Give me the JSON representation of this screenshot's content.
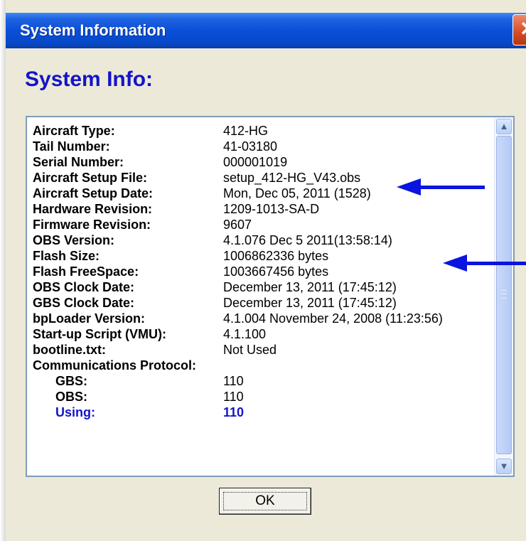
{
  "window": {
    "title": "System Information",
    "close_label": "✕"
  },
  "heading": "System Info:",
  "info_rows": [
    {
      "label": "Aircraft Type:",
      "value": "412-HG"
    },
    {
      "label": "Tail Number:",
      "value": "41-03180"
    },
    {
      "label": "Serial Number:",
      "value": "000001019"
    },
    {
      "label": "Aircraft Setup File:",
      "value": "setup_412-HG_V43.obs"
    },
    {
      "label": "Aircraft Setup Date:",
      "value": "Mon, Dec 05, 2011 (1528)"
    },
    {
      "label": "Hardware Revision:",
      "value": "1209-1013-SA-D"
    },
    {
      "label": "Firmware Revision:",
      "value": "9607"
    },
    {
      "label": "OBS Version:",
      "value": "4.1.076  Dec  5 2011(13:58:14)"
    },
    {
      "label": "Flash Size:",
      "value": "1006862336 bytes"
    },
    {
      "label": "Flash FreeSpace:",
      "value": "1003667456 bytes"
    },
    {
      "label": "OBS Clock Date:",
      "value": "December 13, 2011 (17:45:12)"
    },
    {
      "label": "GBS Clock Date:",
      "value": "December 13, 2011 (17:45:12)"
    },
    {
      "label": "bpLoader Version:",
      "value": "4.1.004 November 24, 2008 (11:23:56)"
    },
    {
      "label": "Start-up Script (VMU):",
      "value": "4.1.100"
    },
    {
      "label": "bootline.txt:",
      "value": "Not Used"
    },
    {
      "label": "Communications Protocol:",
      "value": ""
    },
    {
      "label": "GBS:",
      "value": "110"
    },
    {
      "label": "OBS:",
      "value": "110"
    },
    {
      "label": "Using:",
      "value": "110"
    }
  ],
  "ok_label": "OK",
  "colors": {
    "title_bar": "#0a4fd8",
    "heading": "#1414c8",
    "annotation_arrow": "#0a14e0",
    "using_text": "#1414c8"
  },
  "icons": {
    "scroll_up": "chevron-up-icon",
    "scroll_down": "chevron-down-icon",
    "close": "close-icon"
  }
}
